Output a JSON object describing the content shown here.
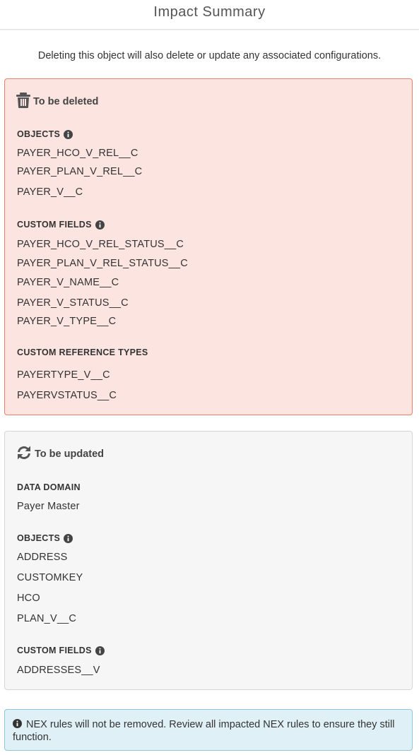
{
  "header": {
    "title": "Impact Summary"
  },
  "intro": {
    "text": "Deleting this object will also delete or update any associated configurations."
  },
  "deleted": {
    "title": "To be deleted",
    "icon": "trash-icon",
    "objects_label": "OBJECTS",
    "objects": [
      "PAYER_HCO_V_REL__C",
      "PAYER_PLAN_V_REL__C",
      "PAYER_V__C"
    ],
    "custom_fields_label": "CUSTOM FIELDS",
    "custom_fields": [
      "PAYER_HCO_V_REL_STATUS__C",
      "PAYER_PLAN_V_REL_STATUS__C",
      "PAYER_V_NAME__C",
      "PAYER_V_STATUS__C",
      "PAYER_V_TYPE__C"
    ],
    "ref_types_label": "CUSTOM REFERENCE TYPES",
    "ref_types": [
      "PAYERTYPE_V__C",
      "PAYERVSTATUS__C"
    ]
  },
  "updated": {
    "title": "To be updated",
    "icon": "refresh-icon",
    "data_domain_label": "DATA DOMAIN",
    "data_domain": "Payer Master",
    "objects_label": "OBJECTS",
    "objects": [
      "ADDRESS",
      "CUSTOMKEY",
      "HCO",
      "PLAN_V__C"
    ],
    "custom_fields_label": "CUSTOM FIELDS",
    "custom_fields": [
      "ADDRESSES__V"
    ]
  },
  "alert": {
    "text": "NEX rules will not be removed. Review all impacted NEX rules to ensure they still function.",
    "icon": "info-circle-icon"
  },
  "colors": {
    "deleted_bg": "#fce5e1",
    "deleted_border": "#e8806f",
    "updated_bg": "#f6f6f6",
    "alert_bg": "#dff0f6",
    "alert_border": "#8ec6d8"
  }
}
